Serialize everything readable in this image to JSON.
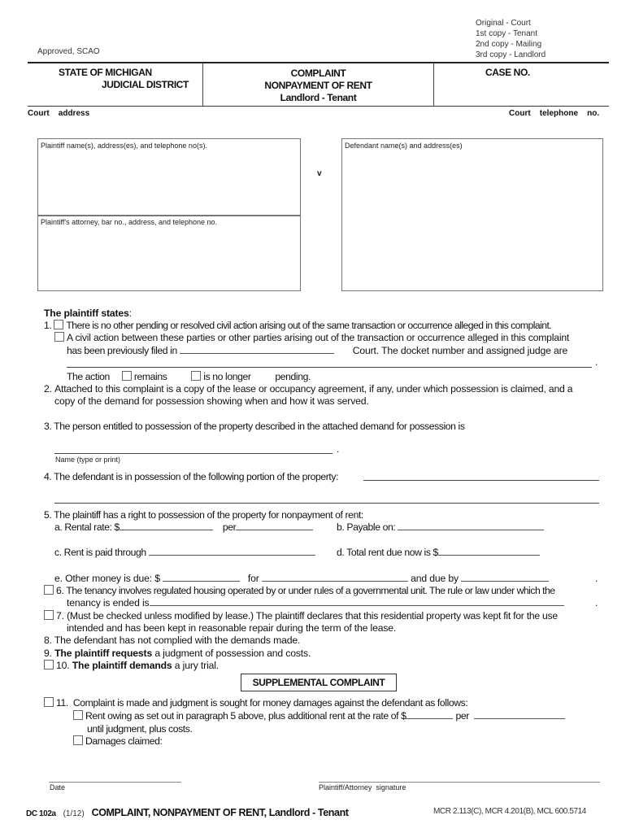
{
  "header": {
    "approved": "Approved, SCAO",
    "copies": [
      "Original - Court",
      "1st copy - Tenant",
      "2nd copy - Mailing",
      "3rd copy - Landlord"
    ],
    "state": "STATE OF MICHIGAN",
    "district": "JUDICIAL DISTRICT",
    "title_lines": [
      "COMPLAINT",
      "NONPAYMENT OF RENT",
      "Landlord - Tenant"
    ],
    "case_no_label": "CASE NO.",
    "court_address_label": "Court    address",
    "court_phone_label": "Court    telephone    no."
  },
  "parties": {
    "plaintiff_label": "Plaintiff name(s), address(es), and telephone no(s).",
    "plaintiff_value": "",
    "attorney_label": "Plaintiff's attorney, bar no., address, and telephone no.",
    "attorney_value": "",
    "versus": "v",
    "defendant_label": "Defendant name(s) and address(es)",
    "defendant_value": ""
  },
  "body": {
    "intro": "The plaintiff states",
    "intro_colon": ":",
    "p1_num": "1.",
    "p1a": "There is no other pending or resolved civil action arising out of the same transaction or occurrence alleged in this complaint.",
    "p1b_line1": "A civil action between these parties or other parties arising out of the transaction or occurrence alleged in this complaint",
    "p1b_line2_pre": "has been previously filed in",
    "p1b_line2_post": "Court.  The docket number and assigned judge are",
    "period": ".",
    "p1c_pre": "The action",
    "p1c_opt1": "remains",
    "p1c_opt2": "is no longer",
    "p1c_post": "pending.",
    "p2_num": "2.",
    "p2_line1": "Attached to this complaint is a copy of the lease or occupancy agreement, if any, under which possession is claimed, and a",
    "p2_line2": "copy  of the demand for possession showing when and how it was served.",
    "p3_num": "3.",
    "p3": "The person entitled to possession of the property described in the attached demand for possession is",
    "p3_name_label": "Name (type or print)",
    "p4_num": "4.",
    "p4": "The defendant is in possession of the following portion of the property:",
    "p5_num": "5.",
    "p5": "The plaintiff has a right to possession of the property for nonpayment of rent:",
    "p5a": "a.  Rental rate:  $",
    "p5a_per": "per",
    "p5b": "b.  Payable on:",
    "p5c": "c.  Rent is paid through",
    "p5d": "d.  Total rent due now is $",
    "p5e": "e.  Other money is due:  $",
    "p5e_for": "for",
    "p5e_due": "and due by",
    "p6_num": "6.",
    "p6_line1": "The tenancy involves regulated housing operated by or under rules of a governmental unit.  The rule or law under which the",
    "p6_line2": "tenancy is ended is",
    "p7_num": "7.",
    "p7_line1": "(Must be checked unless modified by lease.)  The plaintiff declares that this residential property was kept fit for the use",
    "p7_line2": "intended and has been kept in reasonable repair during the term of the lease.",
    "p8": "8.  The defendant has not complied with the demands made.",
    "p9_num": "9.",
    "p9_bold": "The plaintiff requests",
    "p9_rest": " a judgment of possession and costs.",
    "p10_num": "10.",
    "p10_bold": "The plaintiff demands",
    "p10_rest": " a jury trial."
  },
  "supplemental": {
    "title": "SUPPLEMENTAL COMPLAINT",
    "p11_num": "11.",
    "p11": "Complaint is made and judgment is sought for money damages against the defendant as follows:",
    "opt1_line1": "Rent owing as set out in paragraph 5 above, plus additional rent at the rate of $",
    "opt1_per": "per",
    "opt1_line2": "until judgment, plus costs.",
    "opt2": "Damages claimed:"
  },
  "signature": {
    "date_label": "Date",
    "sig_label": "Plaintiff/Attorney  signature"
  },
  "footer": {
    "form_id": "DC 102a",
    "revision": "(1/12)",
    "title": "COMPLAINT, NONPAYMENT OF RENT, Landlord - Tenant",
    "citations": "MCR 2.113(C), MCR 4.201(B), MCL 600.5714"
  }
}
